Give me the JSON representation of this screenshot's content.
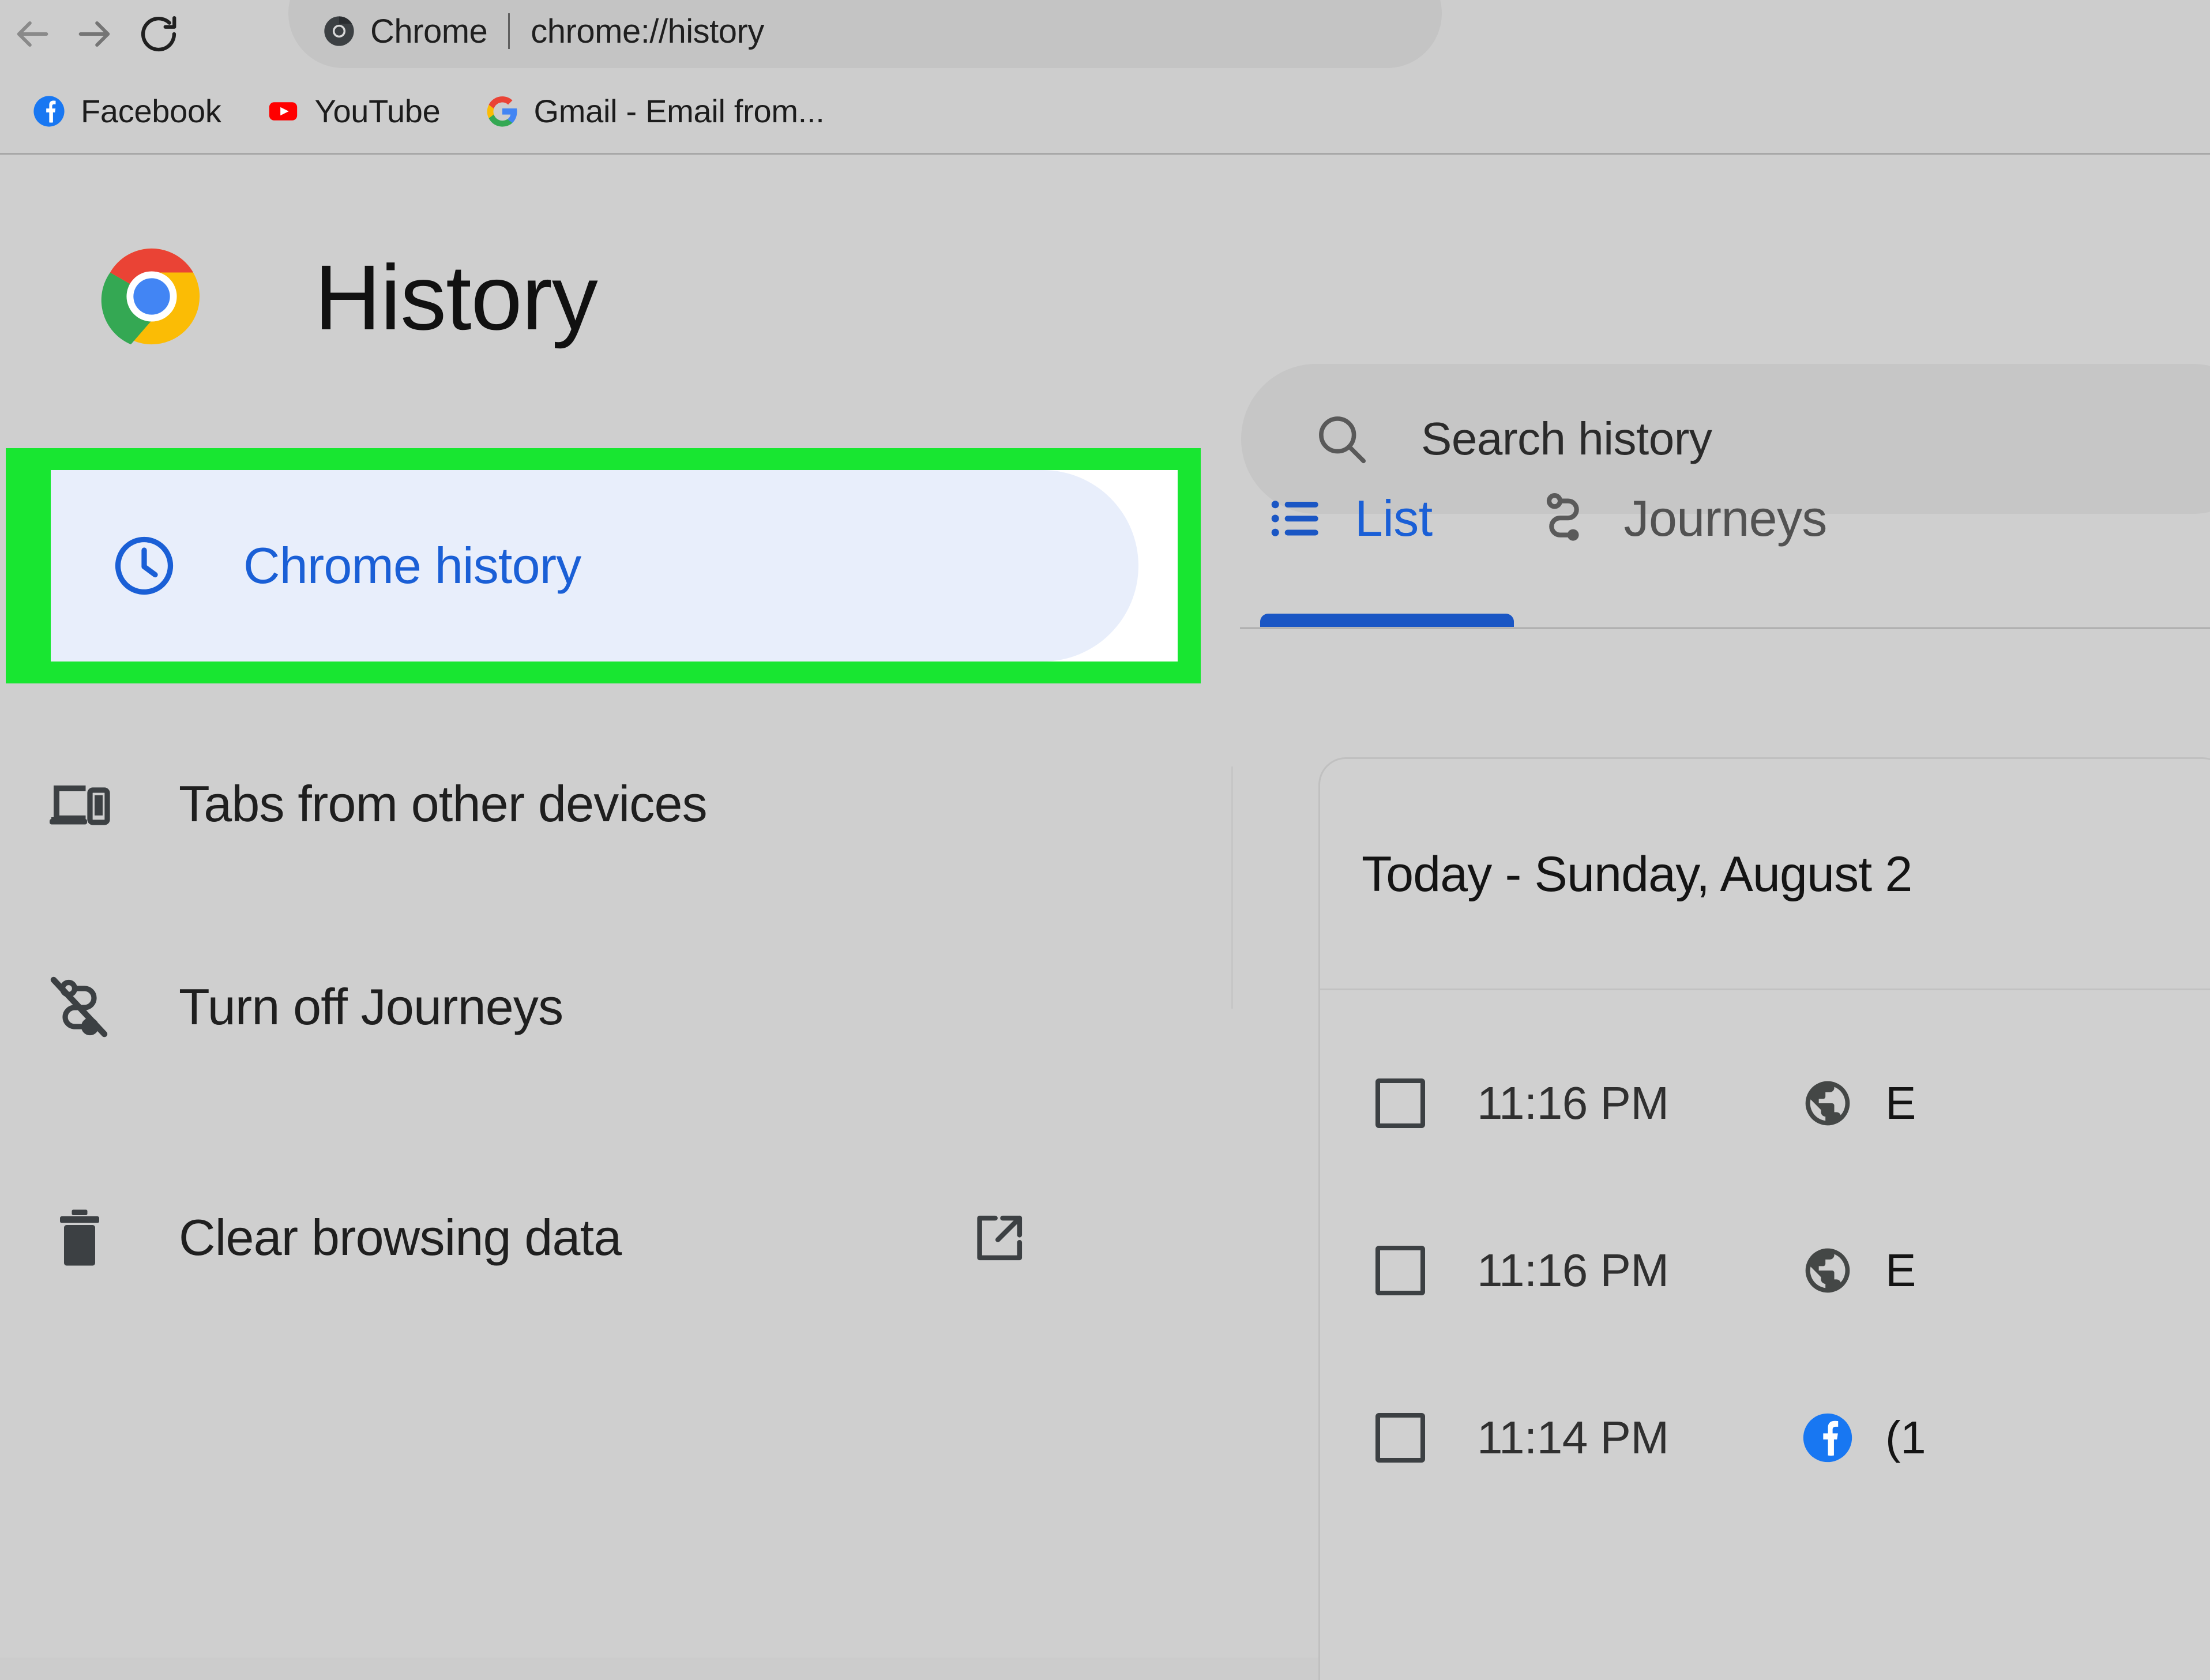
{
  "browser": {
    "back_icon": "arrow-left-icon",
    "forward_icon": "arrow-right-icon",
    "reload_icon": "reload-icon",
    "omnibox": {
      "site_icon": "chrome-logo-icon",
      "site_label": "Chrome",
      "url": "chrome://history"
    },
    "bookmarks": [
      {
        "icon": "facebook-icon",
        "label": "Facebook"
      },
      {
        "icon": "youtube-icon",
        "label": "YouTube"
      },
      {
        "icon": "google-icon",
        "label": "Gmail - Email from..."
      }
    ]
  },
  "header": {
    "logo_icon": "chrome-logo-icon",
    "title": "History"
  },
  "search": {
    "icon": "search-icon",
    "placeholder": "Search history",
    "value": ""
  },
  "sidebar": {
    "items": [
      {
        "icon": "clock-icon",
        "label": "Chrome history",
        "active": true,
        "highlighted": true
      },
      {
        "icon": "devices-icon",
        "label": "Tabs from other devices",
        "active": false
      },
      {
        "icon": "journeys-off-icon",
        "label": "Turn off Journeys",
        "active": false
      },
      {
        "icon": "trash-icon",
        "label": "Clear browsing data",
        "active": false,
        "external_icon": "external-link-icon"
      }
    ]
  },
  "tabs": [
    {
      "icon": "list-icon",
      "label": "List",
      "active": true
    },
    {
      "icon": "journeys-icon",
      "label": "Journeys",
      "active": false
    }
  ],
  "history": {
    "group_header": "Today - Sunday, August 2",
    "rows": [
      {
        "checked": false,
        "time": "11:16 PM",
        "favicon": "globe-icon",
        "title": "E"
      },
      {
        "checked": false,
        "time": "11:16 PM",
        "favicon": "globe-icon",
        "title": "E"
      },
      {
        "checked": false,
        "time": "11:14 PM",
        "favicon": "facebook-icon",
        "title": "(1"
      }
    ]
  },
  "colors": {
    "accent_blue": "#1a5fd6",
    "highlight_green": "#18e631",
    "active_pill_bg": "#e8eefb",
    "page_bg": "#cfcfcf"
  }
}
